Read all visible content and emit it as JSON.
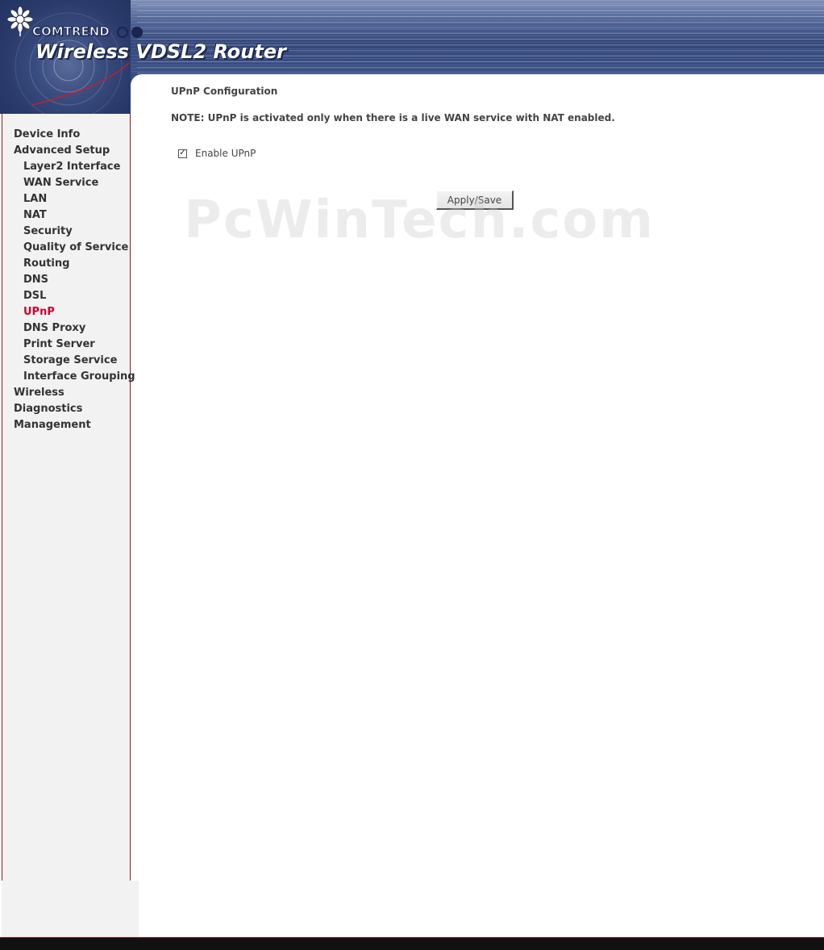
{
  "header": {
    "brand": "COMTREND",
    "product_title": "Wireless VDSL2 Router"
  },
  "sidebar": {
    "items": [
      {
        "label": "Device Info",
        "level": 1
      },
      {
        "label": "Advanced Setup",
        "level": 1
      },
      {
        "label": "Layer2 Interface",
        "level": 2
      },
      {
        "label": "WAN Service",
        "level": 2
      },
      {
        "label": "LAN",
        "level": 2
      },
      {
        "label": "NAT",
        "level": 2
      },
      {
        "label": "Security",
        "level": 2
      },
      {
        "label": "Quality of Service",
        "level": 2
      },
      {
        "label": "Routing",
        "level": 2
      },
      {
        "label": "DNS",
        "level": 2
      },
      {
        "label": "DSL",
        "level": 2
      },
      {
        "label": "UPnP",
        "level": 2,
        "active": true
      },
      {
        "label": "DNS Proxy",
        "level": 2
      },
      {
        "label": "Print Server",
        "level": 2
      },
      {
        "label": "Storage Service",
        "level": 2
      },
      {
        "label": "Interface Grouping",
        "level": 2
      },
      {
        "label": "Wireless",
        "level": 1
      },
      {
        "label": "Diagnostics",
        "level": 1
      },
      {
        "label": "Management",
        "level": 1
      }
    ],
    "active_color": "#cc0033"
  },
  "main": {
    "title": "UPnP Configuration",
    "note": "NOTE: UPnP is activated only when there is a live WAN service with NAT enabled.",
    "enable_upnp": {
      "label": "Enable UPnP",
      "checked": true,
      "check_glyph": "✓"
    },
    "apply_label": "Apply/Save"
  },
  "watermark": "PcWinTech.com"
}
